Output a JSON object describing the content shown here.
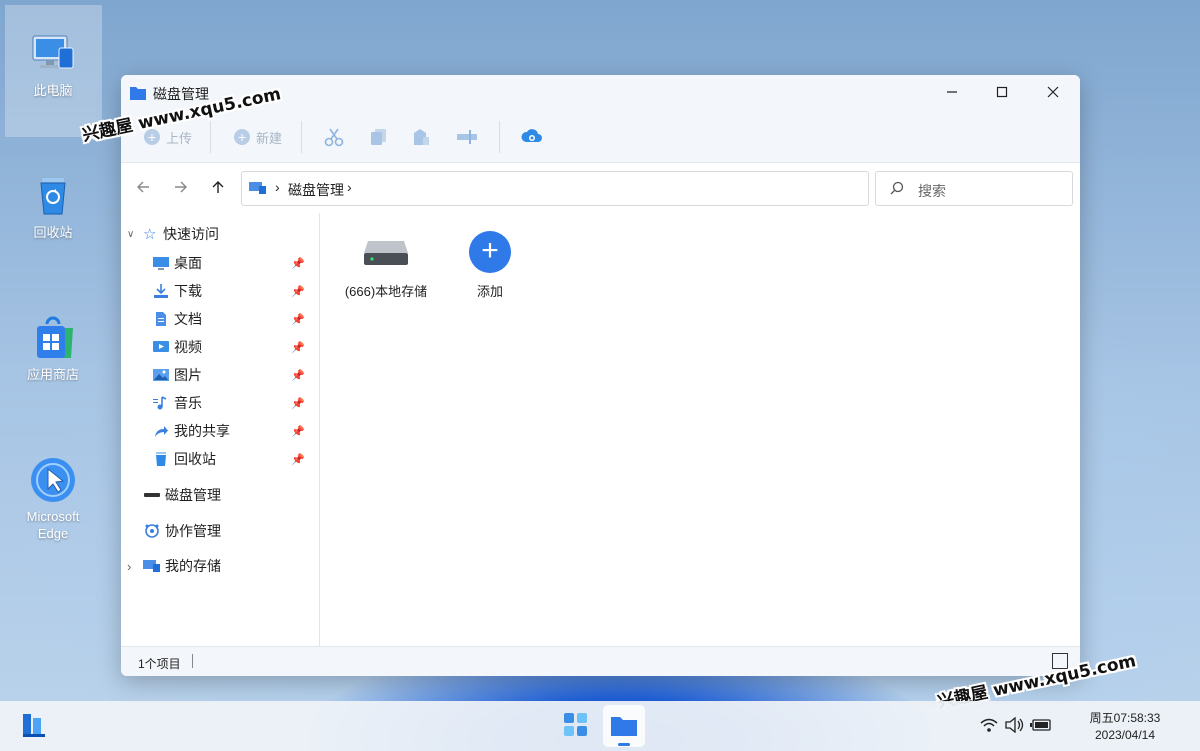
{
  "desktop": {
    "icons": [
      {
        "label": "此电脑",
        "icon": "computer-icon"
      },
      {
        "label": "回收站",
        "icon": "recycle-bin-icon"
      },
      {
        "label": "应用商店",
        "icon": "app-store-icon"
      },
      {
        "label": "Microsoft Edge",
        "icon": "edge-icon"
      }
    ],
    "watermark": "兴趣屋 www.xqu5.com"
  },
  "window": {
    "title": "磁盘管理",
    "toolbar": {
      "upload_label": "上传",
      "new_label": "新建",
      "cut_icon": "scissors-icon",
      "copy_icon": "copy-icon",
      "share_icon": "share-icon",
      "rename_icon": "rename-icon",
      "cloud_icon": "cloud-upload-icon"
    },
    "address": {
      "breadcrumb": "磁盘管理",
      "search_placeholder": "搜索"
    },
    "sidebar": {
      "quick_access": "快速访问",
      "items": [
        {
          "label": "桌面",
          "icon": "desktop-icon"
        },
        {
          "label": "下载",
          "icon": "download-icon"
        },
        {
          "label": "文档",
          "icon": "document-icon"
        },
        {
          "label": "视频",
          "icon": "video-icon"
        },
        {
          "label": "图片",
          "icon": "picture-icon"
        },
        {
          "label": "音乐",
          "icon": "music-icon"
        },
        {
          "label": "我的共享",
          "icon": "share-icon"
        },
        {
          "label": "回收站",
          "icon": "recycle-bin-icon"
        }
      ],
      "disk_mgmt": "磁盘管理",
      "collab_mgmt": "协作管理",
      "my_storage": "我的存储"
    },
    "content": {
      "items": [
        {
          "label": "(666)本地存储",
          "icon": "hard-drive-icon"
        },
        {
          "label": "添加",
          "icon": "add-icon"
        }
      ]
    },
    "status": {
      "count": "1个项目"
    }
  },
  "taskbar": {
    "clock_time": "周五07:58:33",
    "clock_date": "2023/04/14"
  },
  "colors": {
    "accent": "#2f7ae8",
    "window_chrome": "#f3f6fa"
  }
}
